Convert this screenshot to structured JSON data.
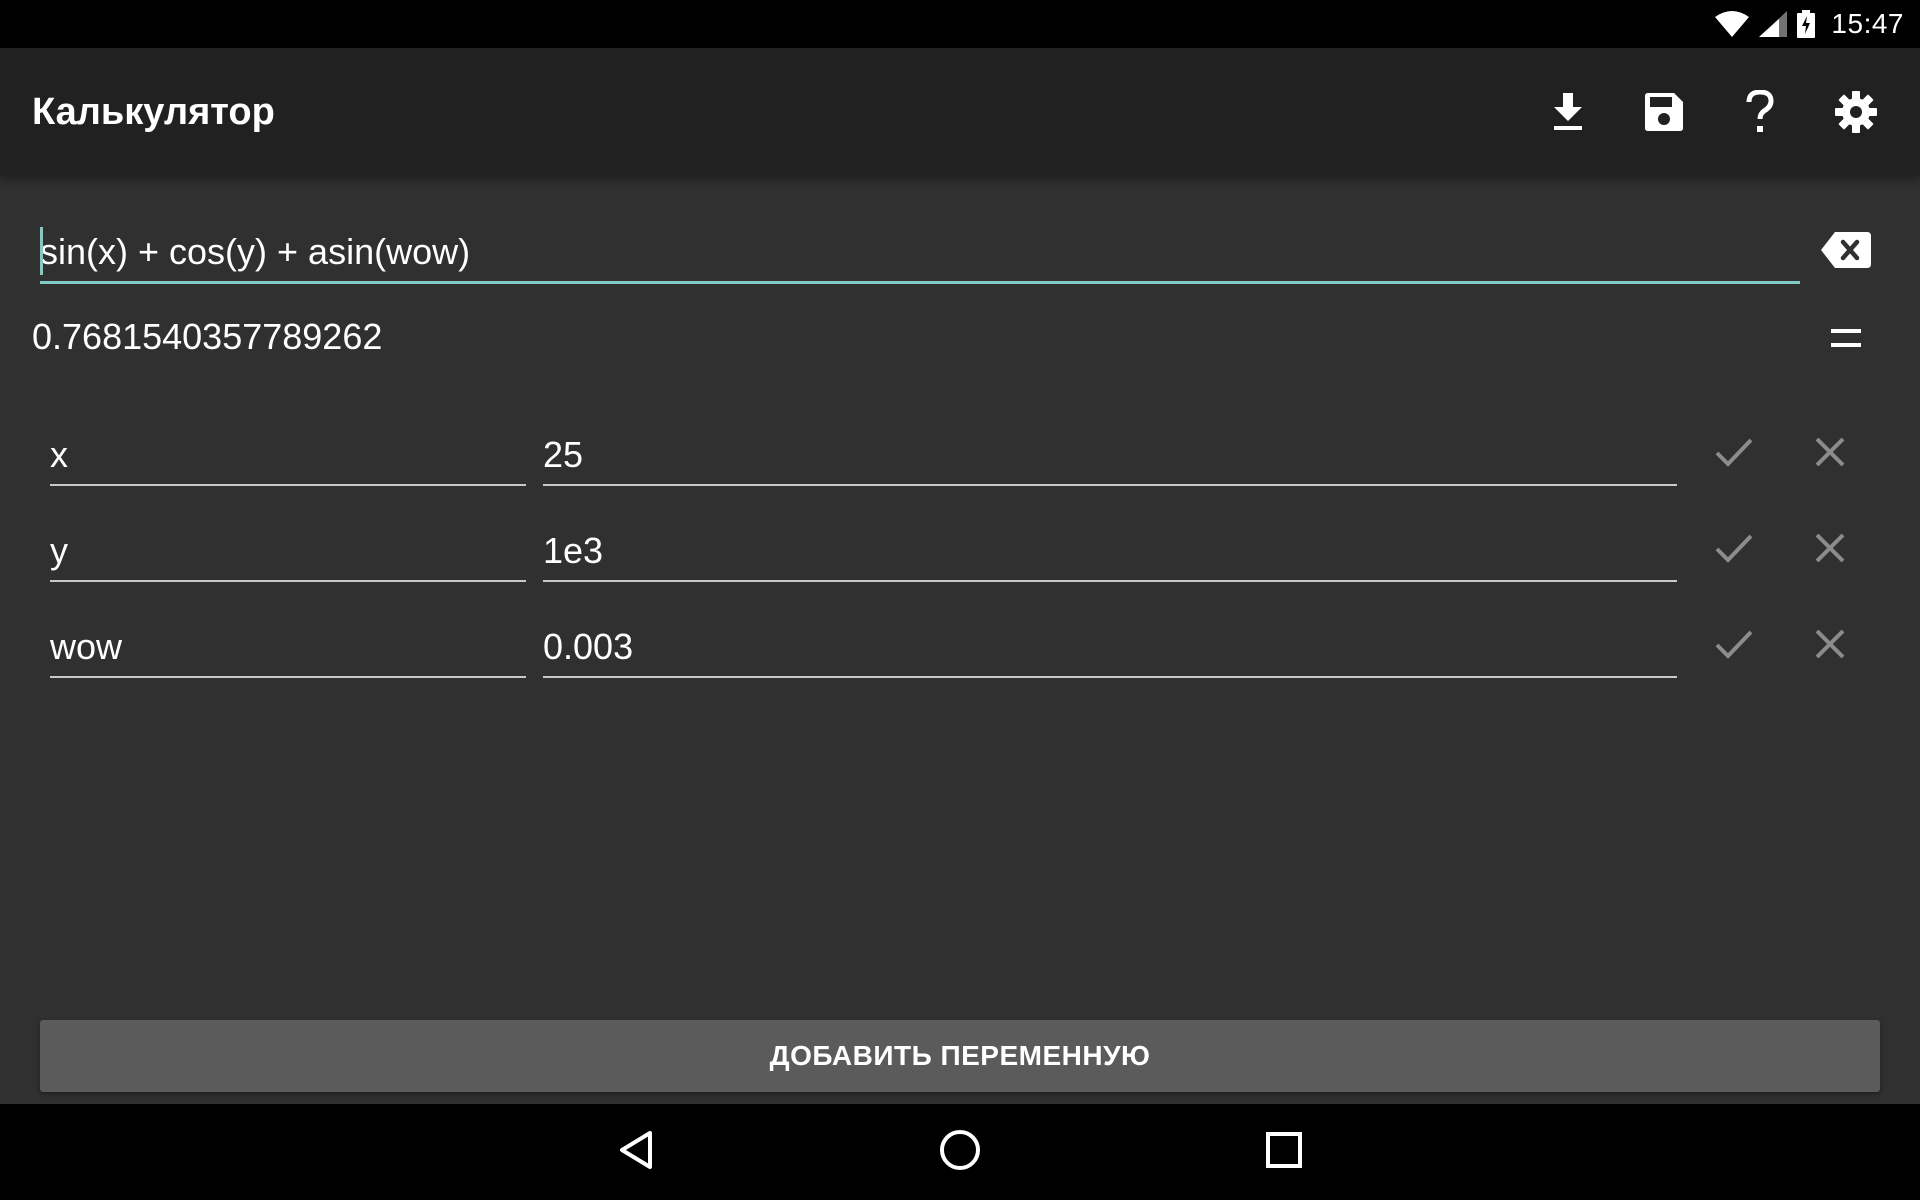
{
  "status_bar": {
    "time": "15:47",
    "icons": [
      "wifi-icon",
      "signal-icon",
      "battery-charging-icon"
    ]
  },
  "app_bar": {
    "title": "Калькулятор",
    "actions": [
      "download-icon",
      "save-icon",
      "help-icon",
      "settings-icon"
    ]
  },
  "expression": {
    "value": "sin(x) + cos(y) + asin(wow)",
    "accent_color": "#80cbc4"
  },
  "result": {
    "value": "0.7681540357789262"
  },
  "variables": [
    {
      "name": "x",
      "value": "25"
    },
    {
      "name": "y",
      "value": "1e3"
    },
    {
      "name": "wow",
      "value": "0.003"
    }
  ],
  "add_variable_label": "ДОБАВИТЬ ПЕРЕМЕННУЮ",
  "nav_bar": [
    "back-icon",
    "home-icon",
    "recents-icon"
  ],
  "colors": {
    "background": "#303030",
    "app_bar": "#212121",
    "button": "#5b5b5b"
  }
}
